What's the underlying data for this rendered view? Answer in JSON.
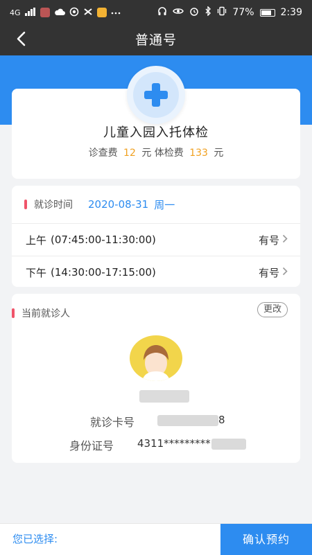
{
  "status_bar": {
    "network": "4G",
    "battery": "77%",
    "time": "2:39",
    "icons": [
      "signal-icon",
      "app-icon",
      "cloud-icon",
      "ring-icon",
      "capcut-icon",
      "app-icon",
      "more-icon",
      "headphone-icon",
      "eye-icon",
      "alarm-icon",
      "bluetooth-icon",
      "vibrate-icon",
      "battery-icon"
    ]
  },
  "nav": {
    "title": "普通号",
    "back_icon": "chevron-left-icon"
  },
  "service": {
    "name": "儿童入园入托体检",
    "fee": {
      "exam_label": "诊查费",
      "exam_amount": "12",
      "unit": "元",
      "checkup_label": "体检费",
      "checkup_amount": "133"
    },
    "icon": "medical-cross-icon"
  },
  "schedule": {
    "visit_time_label": "就诊时间",
    "date": "2020-08-31",
    "weekday": "周一",
    "slots": [
      {
        "period": "上午",
        "time": "(07:45:00-11:30:00)",
        "status": "有号"
      },
      {
        "period": "下午",
        "time": "(14:30:00-17:15:00)",
        "status": "有号"
      }
    ]
  },
  "patient": {
    "title": "当前就诊人",
    "change_label": "更改",
    "card_label": "就诊卡号",
    "card_suffix": "8",
    "id_label": "身份证号",
    "id_visible": "4311*********"
  },
  "bottom": {
    "selected_label": "您已选择:",
    "confirm_label": "确认预约"
  },
  "colors": {
    "accent_blue": "#2d8cf0",
    "fee_orange": "#f0a020",
    "marker_red": "#f0546a",
    "header_dark": "#333333"
  }
}
